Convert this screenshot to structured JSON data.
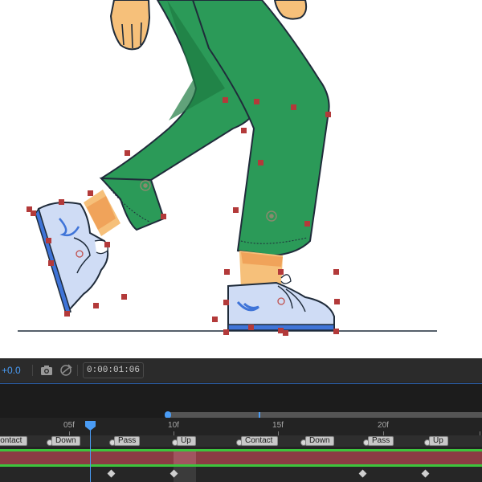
{
  "toolbar": {
    "offset_value": "+0.0",
    "timecode": "0:00:01:06",
    "icons": [
      "camera-icon",
      "show-snapshot-icon"
    ]
  },
  "ruler": {
    "ticks": [
      "05f",
      "10f",
      "15f",
      "20f"
    ]
  },
  "markers": [
    "Contact",
    "Down",
    "Pass",
    "Up",
    "Contact",
    "Down",
    "Pass",
    "Up"
  ],
  "colors": {
    "pants": "#2b9a58",
    "pants_shadow": "#1e7a42",
    "skin": "#f6c07a",
    "shoe": "#cfdcf5",
    "shoe_sole": "#3f74d8",
    "handle": "#b33a3a",
    "playhead": "#4a9cf5",
    "layer_bar": "#8b3c44",
    "layer_outline": "#3dc43d"
  }
}
